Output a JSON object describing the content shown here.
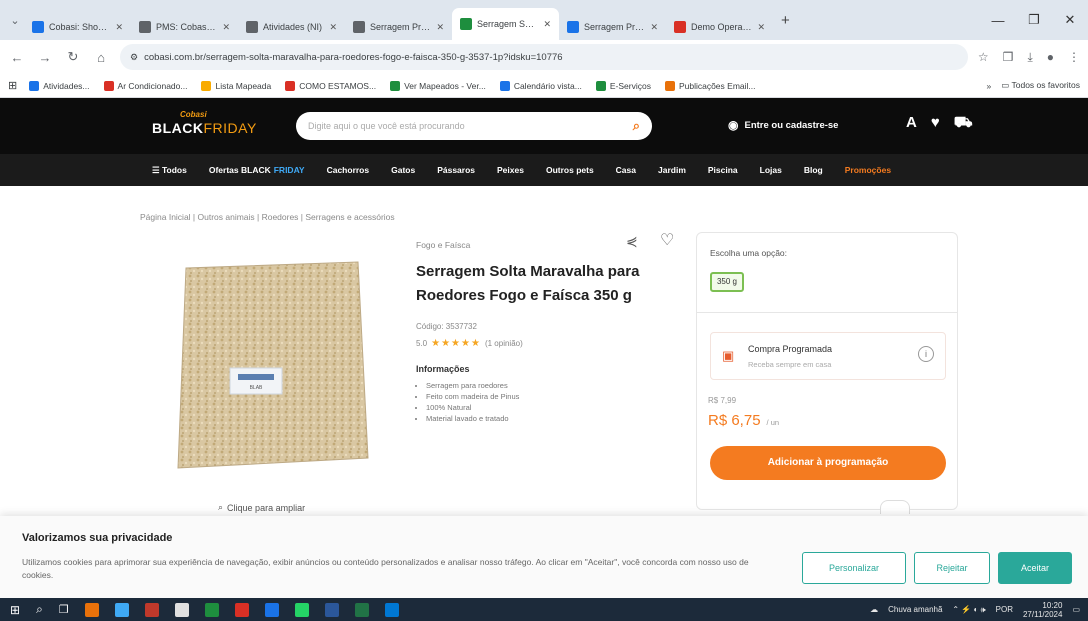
{
  "browser": {
    "tabs": [
      {
        "title": "Cobasi: Shoppin",
        "color": "#1a73e8"
      },
      {
        "title": "PMS: Cobasi di",
        "color": "#5f6368"
      },
      {
        "title": "Atividades (NI)",
        "color": "#5f6368"
      },
      {
        "title": "Serragem Produtos",
        "color": "#5f6368"
      },
      {
        "title": "Serragem Solta Ma...",
        "color": "#1e8e3e",
        "active": true
      },
      {
        "title": "Serragem Procure",
        "color": "#1a73e8"
      },
      {
        "title": "Demo Operação",
        "color": "#d93025"
      }
    ],
    "new_tab": "+",
    "url": "cobasi.com.br/serragem-solta-maravalha-para-roedores-fogo-e-faisca-350-g-3537-1p?idsku=10776",
    "bookmarks": [
      {
        "label": "Atividades...",
        "color": "#1a73e8"
      },
      {
        "label": "Ar Condicionado...",
        "color": "#d93025"
      },
      {
        "label": "Lista Mapeada",
        "color": "#f9ab00"
      },
      {
        "label": "COMO ESTAMOS...",
        "color": "#d93025"
      },
      {
        "label": "Ver Mapeados - Ver...",
        "color": "#1e8e3e"
      },
      {
        "label": "Calendário vista...",
        "color": "#1a73e8"
      },
      {
        "label": "E-Serviços",
        "color": "#1e8e3e"
      },
      {
        "label": "Publicações Email...",
        "color": "#e8710a"
      }
    ],
    "all_bookmarks": "Todos os favoritos"
  },
  "header": {
    "logo_top": "Cobasi",
    "logo_black": "BLACK",
    "logo_friday": "FRIDAY",
    "search_placeholder": "Digite aqui o que você está procurando",
    "login_label": "Entre ou cadastre-se"
  },
  "nav": {
    "items": [
      {
        "label": "☰ Todos",
        "style": "normal"
      },
      {
        "label": "Ofertas BLACK",
        "suffix": "FRIDAY",
        "style": "black"
      },
      {
        "label": "Cachorros",
        "style": "normal"
      },
      {
        "label": "Gatos",
        "style": "normal"
      },
      {
        "label": "Pássaros",
        "style": "normal"
      },
      {
        "label": "Peixes",
        "style": "normal"
      },
      {
        "label": "Outros pets",
        "style": "normal"
      },
      {
        "label": "Casa",
        "style": "normal"
      },
      {
        "label": "Jardim",
        "style": "normal"
      },
      {
        "label": "Piscina",
        "style": "normal"
      },
      {
        "label": "Lojas",
        "style": "normal"
      },
      {
        "label": "Blog",
        "style": "normal"
      },
      {
        "label": "Promoções",
        "style": "highlight"
      }
    ]
  },
  "breadcrumb": "Página Inicial  |  Outros animais  |  Roedores  |  Serragens e acessórios",
  "product": {
    "brand": "Fogo e Faísca",
    "title": "Serragem Solta Maravalha para Roedores Fogo e Faísca 350 g",
    "code": "Código: 3537732",
    "rating_value": "5.0",
    "stars": "★★★★★",
    "rating_count": "(1 opinião)",
    "info_heading": "Informações",
    "info_items": [
      "Serragem para roedores",
      "Feito com madeira de Pinus",
      "100% Natural",
      "Material lavado e tratado"
    ],
    "image_label": "BLAB",
    "zoom_label": "Clique para ampliar"
  },
  "buybox": {
    "option_label": "Escolha uma opção:",
    "option_value": "350 g",
    "program_title": "Compra Programada",
    "program_sub": "Receba sempre em casa",
    "info_icon": "i",
    "old_price": "R$ 7,99",
    "price": "R$ 6,75",
    "unit": "/ un",
    "add_button": "Adicionar à programação"
  },
  "cookie": {
    "title": "Valorizamos sua privacidade",
    "text": "Utilizamos cookies para aprimorar sua experiência de navegação, exibir anúncios ou conteúdo personalizados e analisar nosso tráfego. Ao clicar em \"Aceitar\", você concorda com nosso uso de cookies.",
    "customize": "Personalizar",
    "reject": "Rejeitar",
    "accept": "Aceitar"
  },
  "taskbar": {
    "tray_text": "Chuva amanhã",
    "lang": "POR",
    "time": "10:20",
    "date": "27/11/2024"
  },
  "colors": {
    "accent": "#f47b20",
    "cookie_teal": "#2aa89a",
    "header_black": "#0c0c0c"
  }
}
